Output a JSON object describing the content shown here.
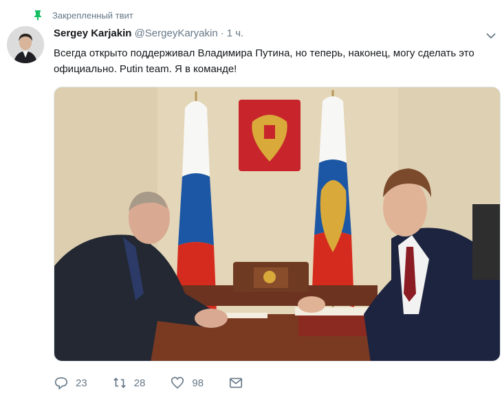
{
  "pinned": {
    "label": "Закрепленный твит",
    "icon": "pin-icon"
  },
  "tweet": {
    "author_name": "Sergey Karjakin",
    "author_handle": "@SergeyKaryakin",
    "separator": "·",
    "time": "1 ч.",
    "text": "Всегда открыто поддерживал Владимира Путина, но теперь, наконец, могу сделать это официально. Putin team. Я в команде!"
  },
  "actions": {
    "replies": "23",
    "retweets": "28",
    "likes": "98"
  },
  "colors": {
    "pin_accent": "#17bf63",
    "muted_text": "#657786",
    "russian_flag": [
      "#ffffff",
      "#1c57a5",
      "#d52b1e"
    ]
  },
  "icons": [
    "pin-icon",
    "avatar",
    "chevron-down-icon",
    "reply-icon",
    "retweet-icon",
    "heart-icon",
    "envelope-icon"
  ]
}
